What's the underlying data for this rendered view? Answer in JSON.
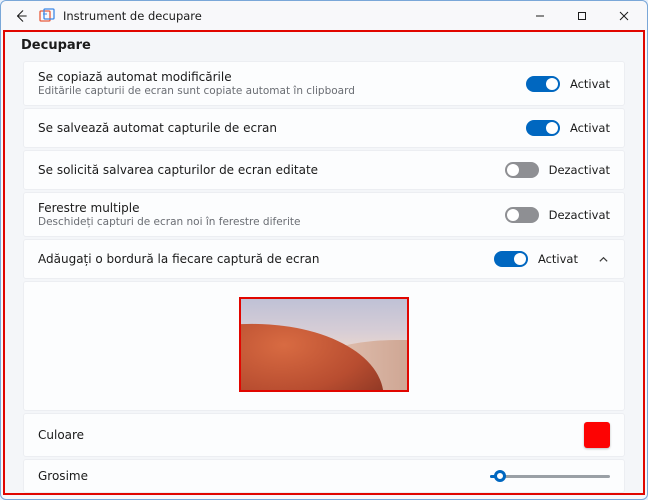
{
  "titlebar": {
    "title": "Instrument de decupare"
  },
  "section_title": "Decupare",
  "rows": [
    {
      "primary": "Se copiază automat modificările",
      "secondary": "Editările capturii de ecran sunt copiate automat în clipboard",
      "state_label": "Activat",
      "on": true
    },
    {
      "primary": "Se salvează automat capturile de ecran",
      "secondary": "",
      "state_label": "Activat",
      "on": true
    },
    {
      "primary": "Se solicită salvarea capturilor de ecran editate",
      "secondary": "",
      "state_label": "Dezactivat",
      "on": false
    },
    {
      "primary": "Ferestre multiple",
      "secondary": "Deschideți capturi de ecran noi în ferestre diferite",
      "state_label": "Dezactivat",
      "on": false
    },
    {
      "primary": "Adăugați o bordură la fiecare captură de ecran",
      "secondary": "",
      "state_label": "Activat",
      "on": true,
      "expandable": true
    }
  ],
  "border_panel": {
    "color_label": "Culoare",
    "color_value": "#fd0303",
    "thickness_label": "Grosime",
    "thickness_percent": 8
  }
}
